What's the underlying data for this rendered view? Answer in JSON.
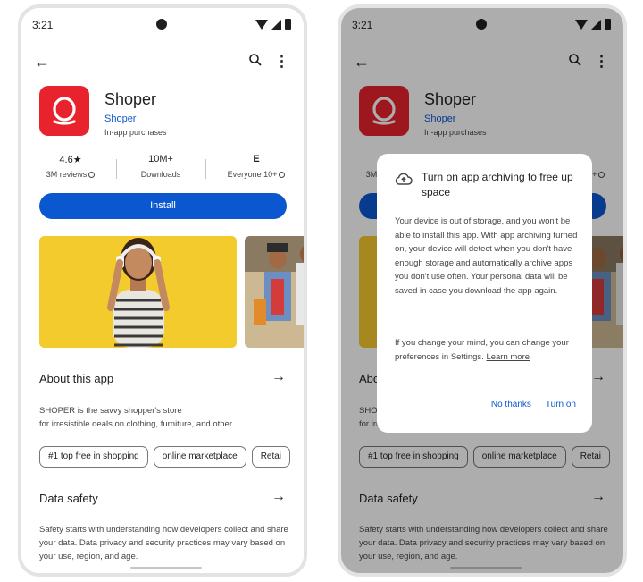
{
  "status": {
    "time": "3:21"
  },
  "app": {
    "name": "Shoper",
    "developer": "Shoper",
    "iap": "In-app purchases",
    "icon_color": "#e8232e"
  },
  "stats": {
    "rating": "4.6★",
    "reviews": "3M reviews",
    "downloads_value": "10M+",
    "downloads_label": "Downloads",
    "rating_badge": "E",
    "content_rating": "Everyone 10+"
  },
  "install_label": "Install",
  "about": {
    "title": "About this app",
    "line1": "SHOPER is the savvy shopper's store",
    "line2": "for irresistible deals on clothing, furniture, and other"
  },
  "chips": [
    "#1 top free in shopping",
    "online marketplace",
    "Retai"
  ],
  "data_safety": {
    "title": "Data safety",
    "body": "Safety starts with understanding how developers collect and share your data. Data privacy and security practices may vary based on your use, region, and age."
  },
  "dialog": {
    "title": "Turn on app archiving to free up space",
    "body": "Your device is out of storage, and you won't be able to install this app. With app archiving turned on, your device will detect when you don't have enough storage and automatically archive apps you don't use often. Your personal data will be saved in case you download the app again.",
    "body2": "If you change your mind, you can change your preferences in Settings.",
    "learn_more": "Learn more",
    "no_thanks": "No thanks",
    "turn_on": "Turn on"
  },
  "colors": {
    "accent": "#0b57d0",
    "scrim": "rgba(0,0,0,0.32)"
  }
}
